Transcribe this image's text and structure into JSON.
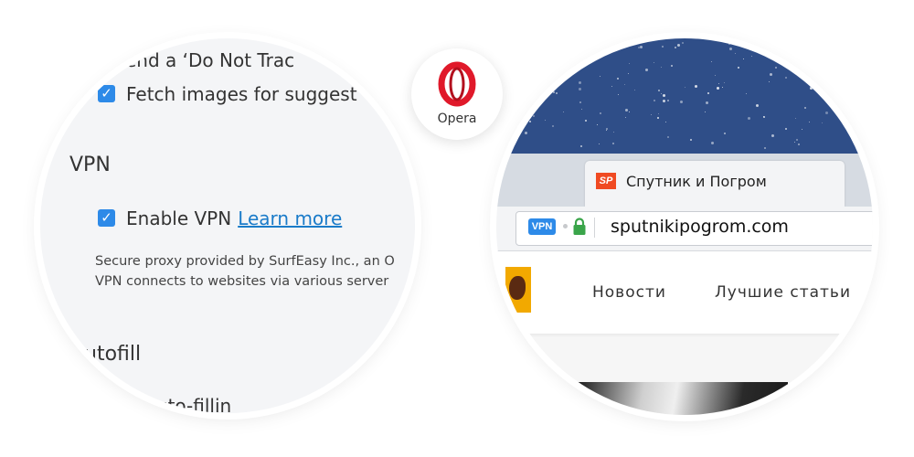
{
  "settings": {
    "do_not_track_label": "end a ‘Do Not Trac",
    "fetch_images_label": "Fetch images for suggest",
    "vpn_heading": "VPN",
    "enable_vpn_label": "Enable VPN",
    "learn_more_link": "Learn more",
    "vpn_description_line1": "Secure proxy provided by SurfEasy Inc., an O",
    "vpn_description_line2": "VPN connects to websites via various server",
    "autofill_heading": "utofill",
    "autofill_option_label": "e auto-fillin",
    "fetch_images_checked": true,
    "enable_vpn_checked": true
  },
  "brand": {
    "name": "Opera",
    "logo_color": "#e0192a"
  },
  "browser": {
    "tab_title": "Спутник и Погром",
    "tab_favicon_text": "SP",
    "vpn_badge": "VPN",
    "url": "sputnikipogrom.com",
    "nav_items": [
      "Новости",
      "Лучшие статьи"
    ]
  },
  "colors": {
    "checkbox_blue": "#2d8ae8",
    "link_blue": "#1a7bc9",
    "sky_blue": "#2f4e88",
    "secure_lock_green": "#3aa54a",
    "favicon_orange": "#f04a22"
  }
}
